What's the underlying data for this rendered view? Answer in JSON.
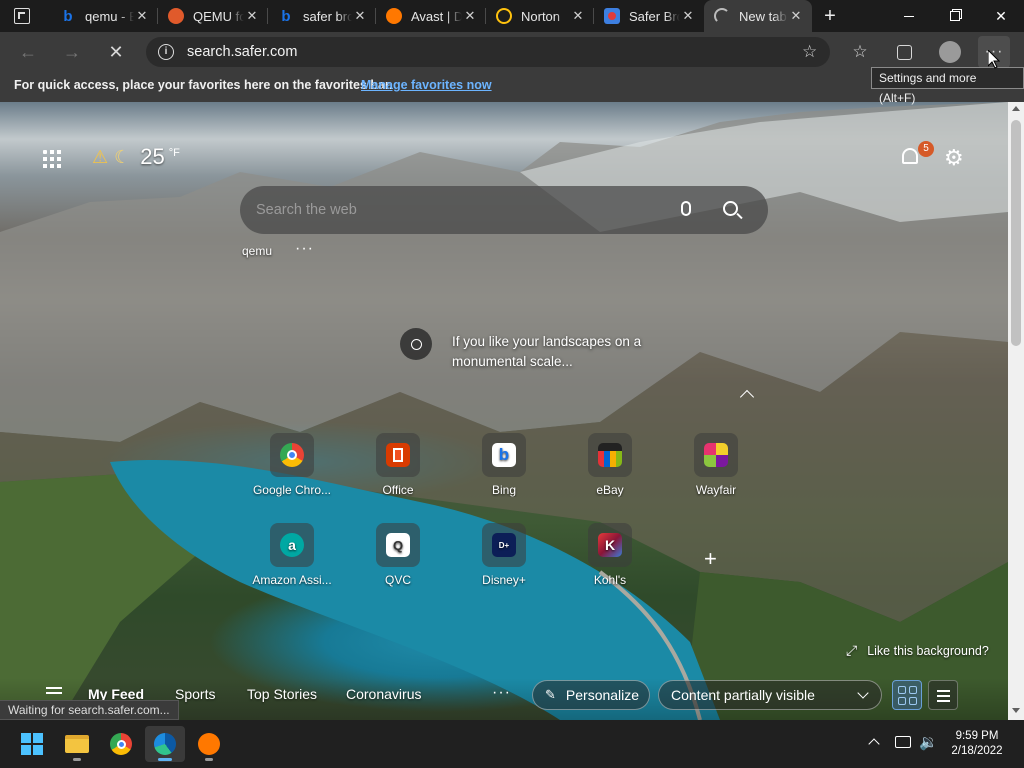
{
  "tabs": [
    {
      "title": "qemu - Bing",
      "icon": "bing-icon",
      "color": "#1a73e8"
    },
    {
      "title": "QEMU for Windows",
      "icon": "qemu-icon",
      "color": "#e05a2b"
    },
    {
      "title": "safer browser",
      "icon": "bing-icon",
      "color": "#1a73e8"
    },
    {
      "title": "Avast | Download",
      "icon": "avast-icon",
      "color": "#ff7800"
    },
    {
      "title": "Norton",
      "icon": "norton-icon",
      "color": "#ffc20e"
    },
    {
      "title": "Safer Browser",
      "icon": "safer-icon",
      "color": "#3d7fe0"
    },
    {
      "title": "New tab",
      "icon": "loading-icon",
      "color": "#cccccc"
    }
  ],
  "toolbar": {
    "url": "search.safer.com",
    "site_info_icon": "info-icon"
  },
  "favbar": {
    "message": "For quick access, place your favorites here on the favorites bar.",
    "link": "Manage favorites now"
  },
  "tooltip": "Settings and more (Alt+F)",
  "newtab": {
    "weather": {
      "temp": "25",
      "unit": "°F"
    },
    "notification_count": "5",
    "search_placeholder": "Search the web",
    "quick_link": "qemu",
    "caption": "If you like your landscapes on a monumental scale...",
    "like_background": "Like this background?",
    "tiles": [
      {
        "label": "Google Chro...",
        "icon": "chrome-icon",
        "color": "#4285f4"
      },
      {
        "label": "Office",
        "icon": "office-icon",
        "color": "#d83b01"
      },
      {
        "label": "Bing",
        "icon": "bing-icon",
        "color": "#ffffff"
      },
      {
        "label": "eBay",
        "icon": "ebay-icon",
        "color": "#222222"
      },
      {
        "label": "Wayfair",
        "icon": "wayfair-icon",
        "color": "#7b189f"
      },
      {
        "label": "Amazon Assi...",
        "icon": "amazon-assistant-icon",
        "color": "#00a8a3"
      },
      {
        "label": "QVC",
        "icon": "qvc-icon",
        "color": "#ffffff"
      },
      {
        "label": "Disney+",
        "icon": "disney-plus-icon",
        "color": "#0c1f57"
      },
      {
        "label": "Kohl's",
        "icon": "kohls-icon",
        "color": "#8a1538"
      }
    ],
    "feed_tabs": [
      "My Feed",
      "Sports",
      "Top Stories",
      "Coronavirus"
    ],
    "personalize": "Personalize",
    "content_visibility": "Content partially visible"
  },
  "status_text": "Waiting for search.safer.com...",
  "clock": {
    "time": "9:59 PM",
    "date": "2/18/2022"
  }
}
